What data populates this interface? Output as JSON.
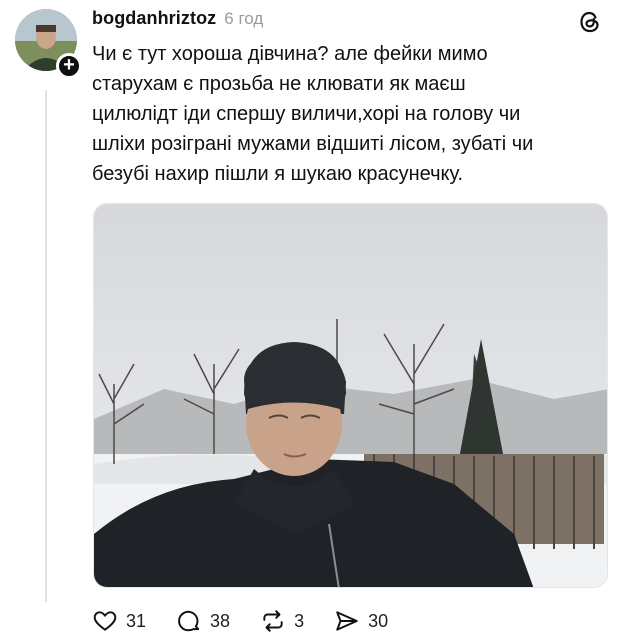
{
  "post": {
    "username": "bogdanhriztoz",
    "time": "6 год",
    "text": "Чи є тут хороша дівчина? але фейки мимо\nстарухам є прозьба не клювати як маєш\nцилюлідт іди спершу виличи,хорі на голову чи\nшліхи розіграні мужами відшиті лісом, зубаті чи\nбезубі нахир пішли я шукаю красунечку.",
    "follow_symbol": "+"
  },
  "actions": {
    "likes": "31",
    "comments": "38",
    "reposts": "3",
    "shares": "30"
  },
  "icons": [
    "threads-logo-icon",
    "heart-icon",
    "comment-icon",
    "repost-icon",
    "share-icon",
    "follow-plus-icon"
  ],
  "colors": {
    "background": "#ffffff",
    "text": "#111111",
    "muted": "#9a9a9a",
    "line": "#e2e2e2"
  }
}
